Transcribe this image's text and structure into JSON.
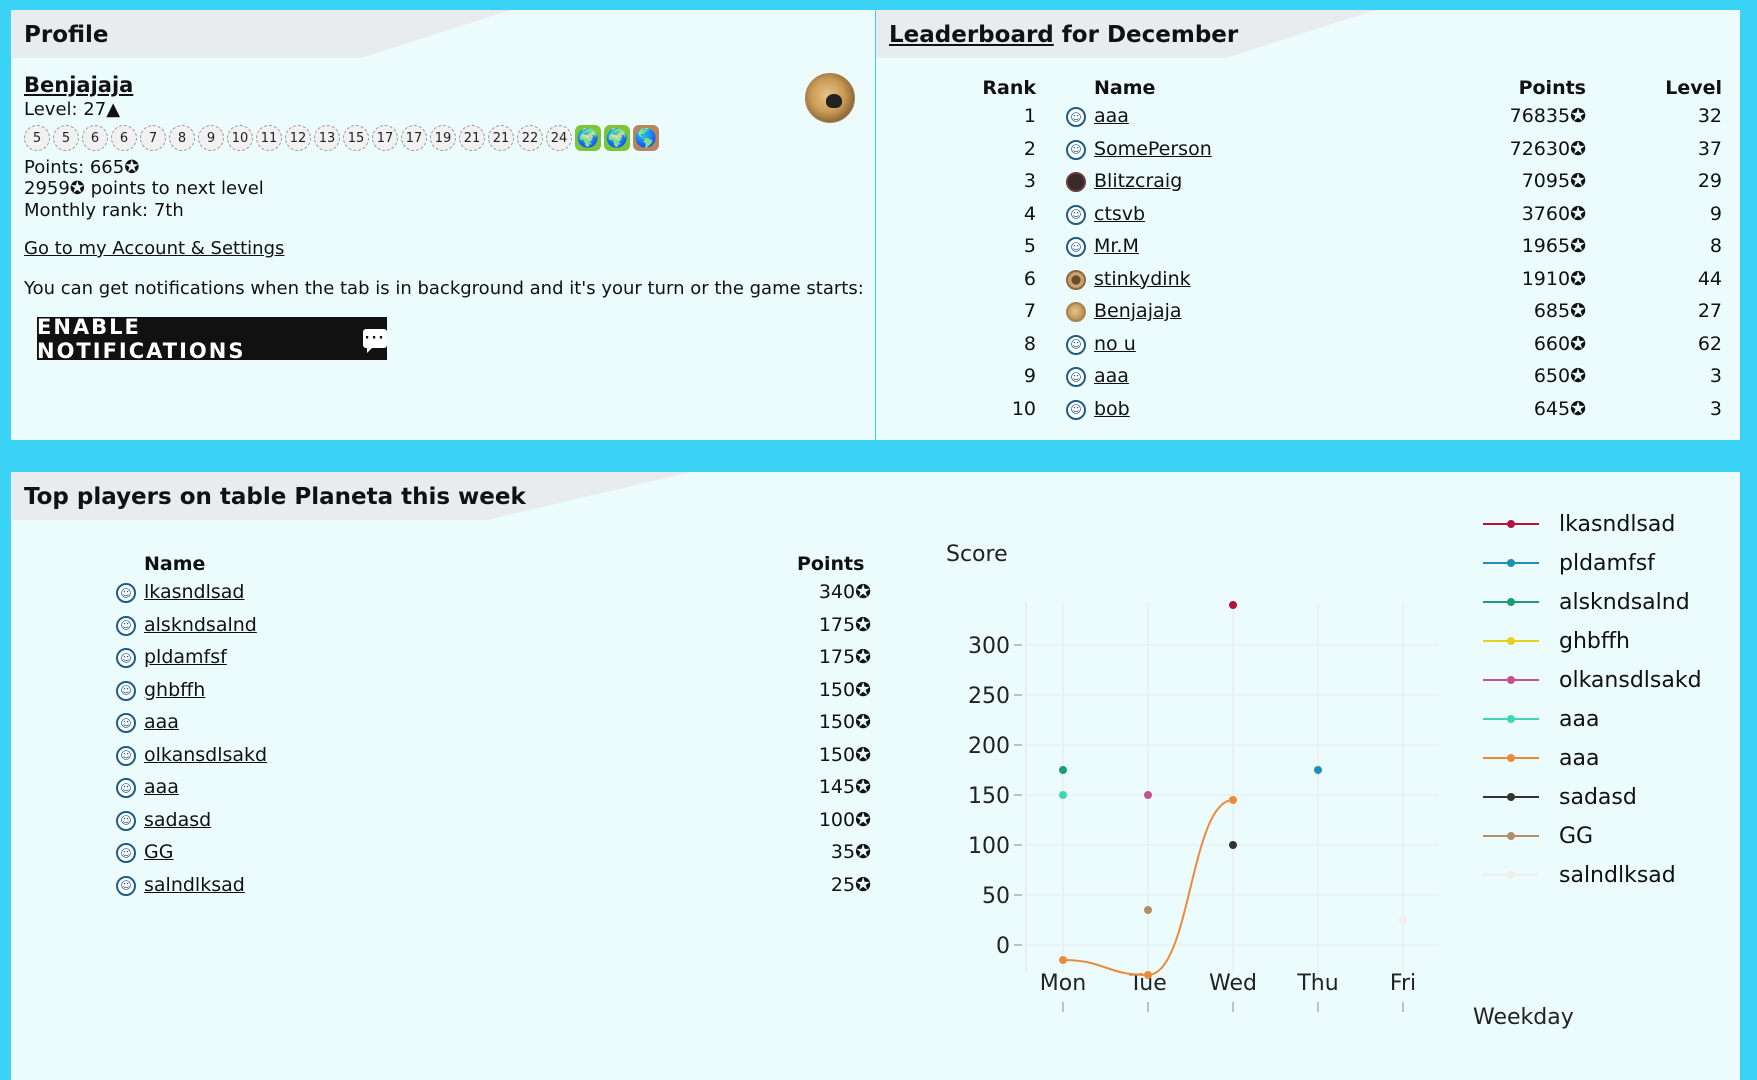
{
  "profile": {
    "title": "Profile",
    "username": "Benjajaja",
    "level": "Level: 27▲",
    "badges": [
      "5",
      "5",
      "6",
      "6",
      "7",
      "8",
      "9",
      "10",
      "11",
      "12",
      "13",
      "15",
      "17",
      "17",
      "19",
      "21",
      "21",
      "22",
      "24"
    ],
    "image_badges": [
      {
        "icon": "globe-badge-icon",
        "color": "#7cc43a",
        "glyph": "🌍"
      },
      {
        "icon": "globe-badge-icon",
        "color": "#7cc43a",
        "glyph": "🌍"
      },
      {
        "icon": "globe-badge-icon",
        "color": "#b8865a",
        "glyph": "🌎"
      }
    ],
    "points": "Points: 665✪",
    "next_level": "2959✪ points to next level",
    "monthly_rank": "Monthly rank: 7th",
    "account_link": "Go to my Account & Settings",
    "notify_text": "You can get notifications when the tab is in background and it's your turn or the game starts:",
    "notify_button": "ENABLE NOTIFICATIONS",
    "avatar_icon": "doge-avatar-icon"
  },
  "leaderboard": {
    "title_link": "Leaderboard",
    "title_rest": " for December",
    "headers": {
      "rank": "Rank",
      "name": "Name",
      "points": "Points",
      "level": "Level"
    },
    "rows": [
      {
        "rank": "1",
        "name": "aaa",
        "points": "76835✪",
        "level": "32",
        "avatar": "default"
      },
      {
        "rank": "2",
        "name": "SomePerson",
        "points": "72630✪",
        "level": "37",
        "avatar": "default"
      },
      {
        "rank": "3",
        "name": "Blitzcraig",
        "points": "7095✪",
        "level": "29",
        "avatar": "dark"
      },
      {
        "rank": "4",
        "name": "ctsvb",
        "points": "3760✪",
        "level": "9",
        "avatar": "default"
      },
      {
        "rank": "5",
        "name": "Mr.M",
        "points": "1965✪",
        "level": "8",
        "avatar": "default"
      },
      {
        "rank": "6",
        "name": "stinkydink",
        "points": "1910✪",
        "level": "44",
        "avatar": "spiky"
      },
      {
        "rank": "7",
        "name": "Benjajaja",
        "points": "685✪",
        "level": "27",
        "avatar": "doge"
      },
      {
        "rank": "8",
        "name": "no u",
        "points": "660✪",
        "level": "62",
        "avatar": "default"
      },
      {
        "rank": "9",
        "name": "aaa",
        "points": "650✪",
        "level": "3",
        "avatar": "default"
      },
      {
        "rank": "10",
        "name": "bob",
        "points": "645✪",
        "level": "3",
        "avatar": "default"
      }
    ]
  },
  "top_players": {
    "title": "Top players on table Planeta this week",
    "headers": {
      "name": "Name",
      "points": "Points"
    },
    "rows": [
      {
        "name": "lkasndlsad",
        "points": "340✪"
      },
      {
        "name": "alskndsalnd",
        "points": "175✪"
      },
      {
        "name": "pldamfsf",
        "points": "175✪"
      },
      {
        "name": "ghbffh",
        "points": "150✪"
      },
      {
        "name": "aaa",
        "points": "150✪"
      },
      {
        "name": "olkansdlsakd",
        "points": "150✪"
      },
      {
        "name": "aaa",
        "points": "145✪"
      },
      {
        "name": "sadasd",
        "points": "100✪"
      },
      {
        "name": "GG",
        "points": "35✪"
      },
      {
        "name": "salndlksad",
        "points": "25✪"
      }
    ]
  },
  "chart_data": {
    "type": "scatter",
    "ylabel": "Score",
    "xlabel": "Weekday",
    "categories": [
      "Mon",
      "Tue",
      "Wed",
      "Thu",
      "Fri"
    ],
    "ylim": [
      -30,
      340
    ],
    "yticks": [
      0,
      50,
      100,
      150,
      200,
      250,
      300
    ],
    "grid": true,
    "legend": "right",
    "series": [
      {
        "name": "lkasndlsad",
        "color": "#b5123e",
        "points": [
          {
            "x": "Wed",
            "y": 340
          }
        ]
      },
      {
        "name": "pldamfsf",
        "color": "#1f8fb5",
        "points": [
          {
            "x": "Thu",
            "y": 175
          }
        ]
      },
      {
        "name": "alskndsalnd",
        "color": "#1a9c7a",
        "points": [
          {
            "x": "Mon",
            "y": 175
          }
        ]
      },
      {
        "name": "ghbffh",
        "color": "#e8d11c",
        "points": []
      },
      {
        "name": "olkansdlsakd",
        "color": "#c7508f",
        "points": [
          {
            "x": "Tue",
            "y": 150
          }
        ]
      },
      {
        "name": "aaa",
        "color": "#40d6b5",
        "points": [
          {
            "x": "Mon",
            "y": 150
          }
        ]
      },
      {
        "name": "aaa",
        "color": "#ec8a3c",
        "points": [
          {
            "x": "Mon",
            "y": -15
          },
          {
            "x": "Tue",
            "y": -30
          },
          {
            "x": "Wed",
            "y": 145
          }
        ],
        "line": true
      },
      {
        "name": "sadasd",
        "color": "#333333",
        "points": [
          {
            "x": "Wed",
            "y": 100
          }
        ]
      },
      {
        "name": "GG",
        "color": "#b0906a",
        "points": [
          {
            "x": "Tue",
            "y": 35
          }
        ]
      },
      {
        "name": "salndlksad",
        "color": "#f4ecec",
        "points": [
          {
            "x": "Fri",
            "y": 25
          }
        ]
      }
    ]
  }
}
